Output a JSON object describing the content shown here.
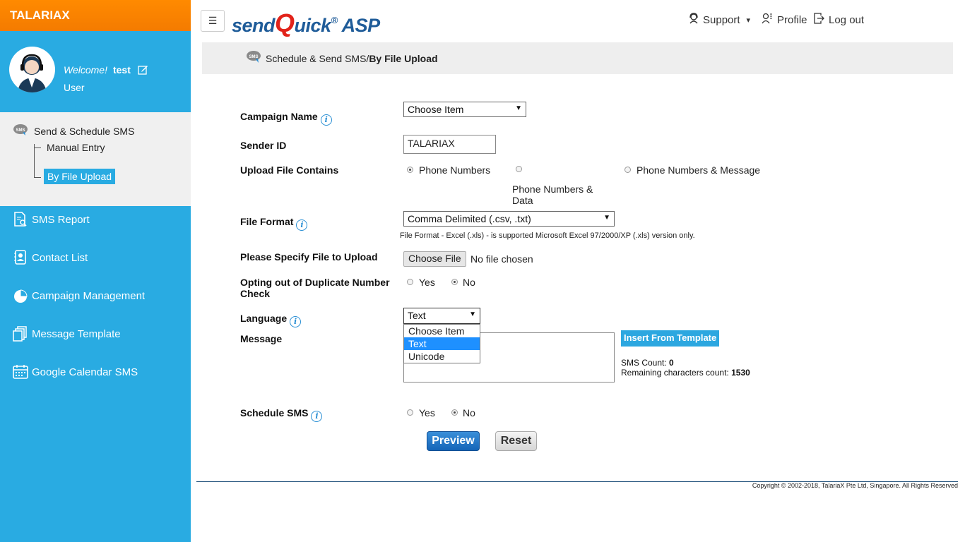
{
  "brand": "TALARIAX",
  "user": {
    "welcome": "Welcome!",
    "name": "test",
    "role": "User"
  },
  "sidebar": {
    "sms_section": {
      "title": "Send & Schedule SMS",
      "items": [
        "Manual Entry",
        "By File Upload"
      ]
    },
    "items": [
      {
        "label": "SMS Report",
        "icon": "report-icon"
      },
      {
        "label": "Contact List",
        "icon": "contact-icon"
      },
      {
        "label": "Campaign Management",
        "icon": "pie-chart-icon"
      },
      {
        "label": "Message Template",
        "icon": "template-icon"
      },
      {
        "label": "Google Calendar SMS",
        "icon": "calendar-icon"
      }
    ]
  },
  "header": {
    "menu_glyph": "☰",
    "logo_pre": "send",
    "logo_q": "Q",
    "logo_post": "uick",
    "logo_reg": "®",
    "logo_asp": "ASP",
    "support": "Support",
    "support_caret": "▾",
    "profile": "Profile",
    "logout": "Log out"
  },
  "breadcrumb": {
    "parent": "Schedule & Send SMS",
    "sep": " / ",
    "current": "By File Upload"
  },
  "form": {
    "campaign_name": {
      "label": "Campaign Name",
      "value": "Choose Item"
    },
    "sender_id": {
      "label": "Sender ID",
      "value": "TALARIAX"
    },
    "upload_contains": {
      "label": "Upload File Contains",
      "options": [
        "Phone Numbers",
        "Phone Numbers & Data",
        "Phone Numbers & Message"
      ],
      "selected": "Phone Numbers"
    },
    "file_format": {
      "label": "File Format",
      "value": "Comma Delimited (.csv, .txt)",
      "note": "File Format - Excel (.xls) - is supported Microsoft Excel 97/2000/XP (.xls) version only."
    },
    "file_upload": {
      "label": "Please Specify File to Upload",
      "button": "Choose File",
      "status": "No file chosen"
    },
    "dup_check": {
      "label": "Opting out of Duplicate Number Check",
      "yes": "Yes",
      "no": "No",
      "selected": "No"
    },
    "language": {
      "label": "Language",
      "value": "Text",
      "options": [
        "Choose Item",
        "Text",
        "Unicode"
      ],
      "highlighted": "Text"
    },
    "message": {
      "label": "Message",
      "template_button": "Insert From Template",
      "sms_count_label": "SMS Count:",
      "sms_count": "0",
      "remaining_label": "Remaining characters count:",
      "remaining": "1530"
    },
    "schedule": {
      "label": "Schedule SMS",
      "yes": "Yes",
      "no": "No",
      "selected": "No"
    },
    "preview": "Preview",
    "reset": "Reset"
  },
  "footer": {
    "copyright": "Copyright © 2002-2018, TalariaX Pte Ltd, Singapore. All Rights Reserved"
  },
  "colors": {
    "sidebar": "#29abe2",
    "brand": "#f47b00",
    "accent": "#1e90ff"
  }
}
